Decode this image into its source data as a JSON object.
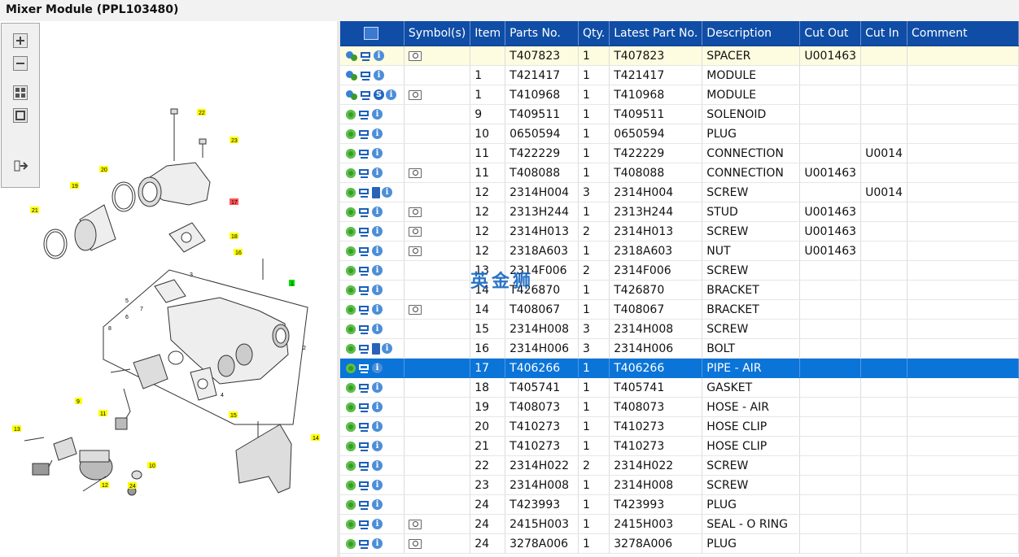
{
  "window": {
    "title": "Mixer Module (PPL103480)"
  },
  "toolbox": {
    "buttons": [
      {
        "name": "zoom-in",
        "icon": "zoom-in-icon"
      },
      {
        "name": "zoom-out",
        "icon": "zoom-out-icon"
      },
      {
        "name": "fit-all",
        "icon": "fit-all-icon"
      },
      {
        "name": "fit-window",
        "icon": "fit-window-icon"
      },
      {
        "name": "export",
        "icon": "export-icon"
      }
    ]
  },
  "diagram": {
    "callouts": [
      "22",
      "23",
      "20",
      "17",
      "19",
      "21",
      "18",
      "16",
      "3",
      "1",
      "5",
      "7",
      "6",
      "8",
      "2",
      "4",
      "9",
      "11",
      "13",
      "15",
      "14",
      "10",
      "12",
      "24"
    ],
    "highlight_color": "#ffff00",
    "selected_callout_color": "#ff5555",
    "current_callout_color": "#00dd00"
  },
  "watermark": "英金狮",
  "grid": {
    "columns": [
      {
        "key": "finder",
        "label": ""
      },
      {
        "key": "symbols",
        "label": "Symbol(s)"
      },
      {
        "key": "item",
        "label": "Item"
      },
      {
        "key": "parts_no",
        "label": "Parts No."
      },
      {
        "key": "qty",
        "label": "Qty."
      },
      {
        "key": "latest_part_no",
        "label": "Latest Part No."
      },
      {
        "key": "description",
        "label": "Description"
      },
      {
        "key": "cut_out",
        "label": "Cut Out"
      },
      {
        "key": "cut_in",
        "label": "Cut In"
      },
      {
        "key": "comment",
        "label": "Comment"
      }
    ],
    "selected_color": "#0b74d8",
    "header_color": "#0f4da6",
    "rows": [
      {
        "icons": [
          "multi-gear-icon",
          "cart-icon",
          "info-icon"
        ],
        "symbol": true,
        "item": "",
        "parts_no": "T407823",
        "qty": "1",
        "latest": "T407823",
        "desc": "SPACER",
        "cut_out": "U001463",
        "cut_in": "",
        "comment": "",
        "state": "highlight"
      },
      {
        "icons": [
          "multi-gear-icon",
          "cart-icon",
          "info-icon"
        ],
        "symbol": false,
        "item": "1",
        "parts_no": "T421417",
        "qty": "1",
        "latest": "T421417",
        "desc": "MODULE",
        "cut_out": "",
        "cut_in": "",
        "comment": "",
        "state": ""
      },
      {
        "icons": [
          "multi-gear-icon",
          "cart-icon",
          "s-icon",
          "info-icon"
        ],
        "symbol": true,
        "item": "1",
        "parts_no": "T410968",
        "qty": "1",
        "latest": "T410968",
        "desc": "MODULE",
        "cut_out": "",
        "cut_in": "",
        "comment": "",
        "state": ""
      },
      {
        "icons": [
          "gear-icon",
          "cart-icon",
          "info-icon"
        ],
        "symbol": false,
        "item": "9",
        "parts_no": "T409511",
        "qty": "1",
        "latest": "T409511",
        "desc": "SOLENOID",
        "cut_out": "",
        "cut_in": "",
        "comment": "",
        "state": ""
      },
      {
        "icons": [
          "gear-icon",
          "cart-icon",
          "info-icon"
        ],
        "symbol": false,
        "item": "10",
        "parts_no": "0650594",
        "qty": "1",
        "latest": "0650594",
        "desc": "PLUG",
        "cut_out": "",
        "cut_in": "",
        "comment": "",
        "state": ""
      },
      {
        "icons": [
          "gear-icon",
          "cart-icon",
          "info-icon"
        ],
        "symbol": false,
        "item": "11",
        "parts_no": "T422229",
        "qty": "1",
        "latest": "T422229",
        "desc": "CONNECTION",
        "cut_out": "",
        "cut_in": "U0014",
        "comment": "",
        "state": ""
      },
      {
        "icons": [
          "gear-icon",
          "cart-icon",
          "info-icon"
        ],
        "symbol": true,
        "item": "11",
        "parts_no": "T408088",
        "qty": "1",
        "latest": "T408088",
        "desc": "CONNECTION",
        "cut_out": "U001463",
        "cut_in": "",
        "comment": "",
        "state": ""
      },
      {
        "icons": [
          "gear-icon",
          "cart-icon",
          "book-icon",
          "info-icon"
        ],
        "symbol": false,
        "item": "12",
        "parts_no": "2314H004",
        "qty": "3",
        "latest": "2314H004",
        "desc": "SCREW",
        "cut_out": "",
        "cut_in": "U0014",
        "comment": "",
        "state": ""
      },
      {
        "icons": [
          "gear-icon",
          "cart-icon",
          "info-icon"
        ],
        "symbol": true,
        "item": "12",
        "parts_no": "2313H244",
        "qty": "1",
        "latest": "2313H244",
        "desc": "STUD",
        "cut_out": "U001463",
        "cut_in": "",
        "comment": "",
        "state": ""
      },
      {
        "icons": [
          "gear-icon",
          "cart-icon",
          "info-icon"
        ],
        "symbol": true,
        "item": "12",
        "parts_no": "2314H013",
        "qty": "2",
        "latest": "2314H013",
        "desc": "SCREW",
        "cut_out": "U001463",
        "cut_in": "",
        "comment": "",
        "state": ""
      },
      {
        "icons": [
          "gear-icon",
          "cart-icon",
          "info-icon"
        ],
        "symbol": true,
        "item": "12",
        "parts_no": "2318A603",
        "qty": "1",
        "latest": "2318A603",
        "desc": "NUT",
        "cut_out": "U001463",
        "cut_in": "",
        "comment": "",
        "state": ""
      },
      {
        "icons": [
          "gear-icon",
          "cart-icon",
          "info-icon"
        ],
        "symbol": false,
        "item": "13",
        "parts_no": "2314F006",
        "qty": "2",
        "latest": "2314F006",
        "desc": "SCREW",
        "cut_out": "",
        "cut_in": "",
        "comment": "",
        "state": ""
      },
      {
        "icons": [
          "gear-icon",
          "cart-icon",
          "info-icon"
        ],
        "symbol": false,
        "item": "14",
        "parts_no": "T426870",
        "qty": "1",
        "latest": "T426870",
        "desc": "BRACKET",
        "cut_out": "",
        "cut_in": "",
        "comment": "",
        "state": ""
      },
      {
        "icons": [
          "gear-icon",
          "cart-icon",
          "info-icon"
        ],
        "symbol": true,
        "item": "14",
        "parts_no": "T408067",
        "qty": "1",
        "latest": "T408067",
        "desc": "BRACKET",
        "cut_out": "",
        "cut_in": "",
        "comment": "",
        "state": ""
      },
      {
        "icons": [
          "gear-icon",
          "cart-icon",
          "info-icon"
        ],
        "symbol": false,
        "item": "15",
        "parts_no": "2314H008",
        "qty": "3",
        "latest": "2314H008",
        "desc": "SCREW",
        "cut_out": "",
        "cut_in": "",
        "comment": "",
        "state": ""
      },
      {
        "icons": [
          "gear-icon",
          "cart-icon",
          "book-icon",
          "info-icon"
        ],
        "symbol": false,
        "item": "16",
        "parts_no": "2314H006",
        "qty": "3",
        "latest": "2314H006",
        "desc": "BOLT",
        "cut_out": "",
        "cut_in": "",
        "comment": "",
        "state": ""
      },
      {
        "icons": [
          "gear-icon",
          "cart-icon",
          "info-icon"
        ],
        "symbol": false,
        "item": "17",
        "parts_no": "T406266",
        "qty": "1",
        "latest": "T406266",
        "desc": "PIPE - AIR",
        "cut_out": "",
        "cut_in": "",
        "comment": "",
        "state": "selected"
      },
      {
        "icons": [
          "gear-icon",
          "cart-icon",
          "info-icon"
        ],
        "symbol": false,
        "item": "18",
        "parts_no": "T405741",
        "qty": "1",
        "latest": "T405741",
        "desc": "GASKET",
        "cut_out": "",
        "cut_in": "",
        "comment": "",
        "state": ""
      },
      {
        "icons": [
          "gear-icon",
          "cart-icon",
          "info-icon"
        ],
        "symbol": false,
        "item": "19",
        "parts_no": "T408073",
        "qty": "1",
        "latest": "T408073",
        "desc": "HOSE - AIR",
        "cut_out": "",
        "cut_in": "",
        "comment": "",
        "state": ""
      },
      {
        "icons": [
          "gear-icon",
          "cart-icon",
          "info-icon"
        ],
        "symbol": false,
        "item": "20",
        "parts_no": "T410273",
        "qty": "1",
        "latest": "T410273",
        "desc": "HOSE CLIP",
        "cut_out": "",
        "cut_in": "",
        "comment": "",
        "state": ""
      },
      {
        "icons": [
          "gear-icon",
          "cart-icon",
          "info-icon"
        ],
        "symbol": false,
        "item": "21",
        "parts_no": "T410273",
        "qty": "1",
        "latest": "T410273",
        "desc": "HOSE CLIP",
        "cut_out": "",
        "cut_in": "",
        "comment": "",
        "state": ""
      },
      {
        "icons": [
          "gear-icon",
          "cart-icon",
          "info-icon"
        ],
        "symbol": false,
        "item": "22",
        "parts_no": "2314H022",
        "qty": "2",
        "latest": "2314H022",
        "desc": "SCREW",
        "cut_out": "",
        "cut_in": "",
        "comment": "",
        "state": ""
      },
      {
        "icons": [
          "gear-icon",
          "cart-icon",
          "info-icon"
        ],
        "symbol": false,
        "item": "23",
        "parts_no": "2314H008",
        "qty": "1",
        "latest": "2314H008",
        "desc": "SCREW",
        "cut_out": "",
        "cut_in": "",
        "comment": "",
        "state": ""
      },
      {
        "icons": [
          "gear-icon",
          "cart-icon",
          "info-icon"
        ],
        "symbol": false,
        "item": "24",
        "parts_no": "T423993",
        "qty": "1",
        "latest": "T423993",
        "desc": "PLUG",
        "cut_out": "",
        "cut_in": "",
        "comment": "",
        "state": ""
      },
      {
        "icons": [
          "gear-icon",
          "cart-icon",
          "info-icon"
        ],
        "symbol": true,
        "item": "24",
        "parts_no": "2415H003",
        "qty": "1",
        "latest": "2415H003",
        "desc": "SEAL - O RING",
        "cut_out": "",
        "cut_in": "",
        "comment": "",
        "state": ""
      },
      {
        "icons": [
          "gear-icon",
          "cart-icon",
          "info-icon"
        ],
        "symbol": true,
        "item": "24",
        "parts_no": "3278A006",
        "qty": "1",
        "latest": "3278A006",
        "desc": "PLUG",
        "cut_out": "",
        "cut_in": "",
        "comment": "",
        "state": ""
      }
    ]
  }
}
